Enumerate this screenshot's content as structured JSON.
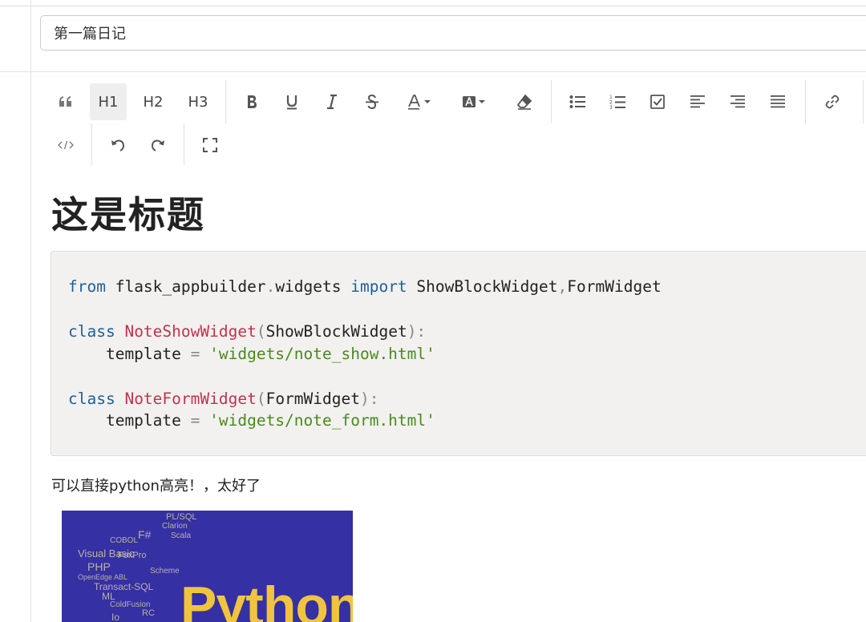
{
  "title_input": {
    "value": "第一篇日记"
  },
  "toolbar": {
    "h1": "H1",
    "h2": "H2",
    "h3": "H3"
  },
  "content": {
    "heading": "这是标题",
    "code_lines": [
      "from flask_appbuilder.widgets import ShowBlockWidget,FormWidget",
      "",
      "class NoteShowWidget(ShowBlockWidget):",
      "    template = 'widgets/note_show.html'",
      "",
      "class NoteFormWidget(FormWidget):",
      "    template = 'widgets/note_form.html'"
    ],
    "paragraph": "可以直接python高亮！，太好了",
    "image": {
      "word": "Python",
      "languages": [
        "PL/SQL",
        "Clarion",
        "Scala",
        "F#",
        "COBOL",
        "Visual Basic",
        "FoxPro",
        "PHP",
        "OpenEdge ABL",
        "Scheme",
        "Transact-SQL",
        "ML",
        "ColdFusion",
        "Io",
        "RC"
      ],
      "background_color": "#3530a3",
      "word_color": "#f0c43e"
    }
  },
  "icons": [
    "quote-icon",
    "bold-icon",
    "underline-icon",
    "italic-icon",
    "strikethrough-icon",
    "font-color-icon",
    "background-color-icon",
    "eraser-icon",
    "bullet-list-icon",
    "numbered-list-icon",
    "checklist-icon",
    "align-left-icon",
    "align-right-icon",
    "align-justify-icon",
    "link-icon",
    "code-icon",
    "undo-icon",
    "redo-icon",
    "fullscreen-icon"
  ]
}
